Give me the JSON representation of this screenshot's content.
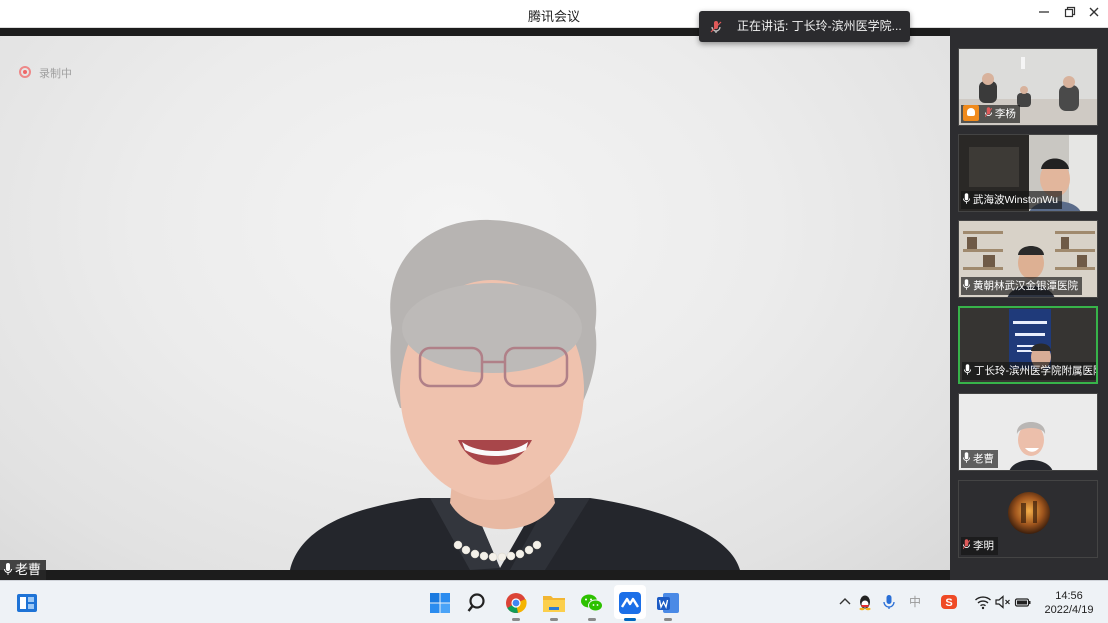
{
  "window": {
    "title": "腾讯会议"
  },
  "speaking_banner": {
    "text": "正在讲话: 丁长玲-滨州医学院..."
  },
  "main_video": {
    "recording_label": "录制中",
    "participant_name": "老曹"
  },
  "participants": [
    {
      "name": "李杨",
      "badge": "host-avatar-icon",
      "mic": "muted"
    },
    {
      "name": "武海波WinstonWu",
      "mic": "on"
    },
    {
      "name": "黄朝林武汉金银潭医院",
      "mic": "on"
    },
    {
      "name": "丁长玲-滨州医学院附属医院",
      "mic": "on",
      "speaking": true
    },
    {
      "name": "老曹",
      "mic": "on"
    },
    {
      "name": "李明",
      "mic": "muted"
    }
  ],
  "taskbar": {
    "apps": [
      "widgets-icon",
      "start-icon",
      "search-icon",
      "chrome-icon",
      "file-explorer-icon",
      "wechat-icon",
      "tencent-meeting-icon",
      "word-icon"
    ],
    "tray": [
      "chevron-up-icon",
      "qq-icon",
      "microphone-icon",
      "ime-icon",
      "sogou-icon",
      "wifi-icon",
      "volume-muted-icon",
      "battery-icon"
    ],
    "ime_label": "中",
    "time": "14:56",
    "date": "2022/4/19"
  },
  "colors": {
    "active_border": "#37b34a",
    "sidebar_bg": "#2d2d30",
    "accent": "#0067c0"
  }
}
